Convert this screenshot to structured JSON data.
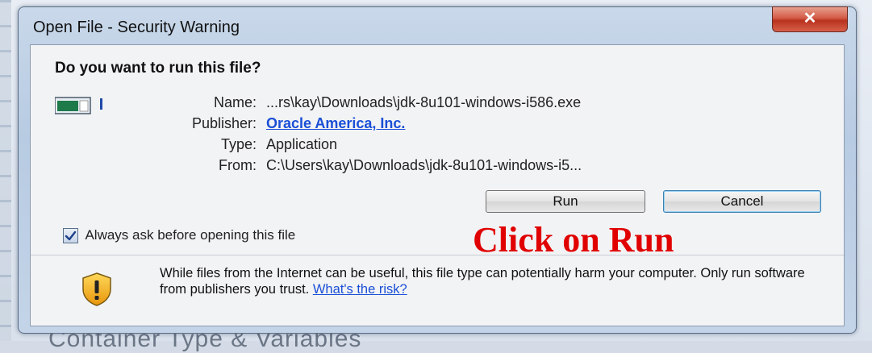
{
  "window": {
    "title": "Open File - Security Warning",
    "close_label": "✕"
  },
  "dialog": {
    "question": "Do you want to run this file?",
    "labels": {
      "name": "Name:",
      "publisher": "Publisher:",
      "type": "Type:",
      "from": "From:"
    },
    "values": {
      "name": "...rs\\kay\\Downloads\\jdk-8u101-windows-i586.exe",
      "publisher": "Oracle America, Inc.",
      "type": "Application",
      "from": "C:\\Users\\kay\\Downloads\\jdk-8u101-windows-i5..."
    },
    "buttons": {
      "run": "Run",
      "cancel": "Cancel"
    },
    "checkbox": {
      "label": "Always ask before opening this file",
      "checked": true
    },
    "annotation": "Click on Run",
    "warning": {
      "text": "While files from the Internet can be useful, this file type can potentially harm your computer. Only run software from publishers you trust.",
      "link": "What's the risk?"
    }
  },
  "background": {
    "partial_text": "Container Type & Variables"
  },
  "colors": {
    "annotation": "#e00000",
    "link": "#1a4fd6",
    "close_button": "#c8402c"
  },
  "icons": {
    "app": "application-window-icon",
    "shield": "security-shield-warning-icon",
    "check": "checkmark-icon",
    "close": "close-icon"
  }
}
